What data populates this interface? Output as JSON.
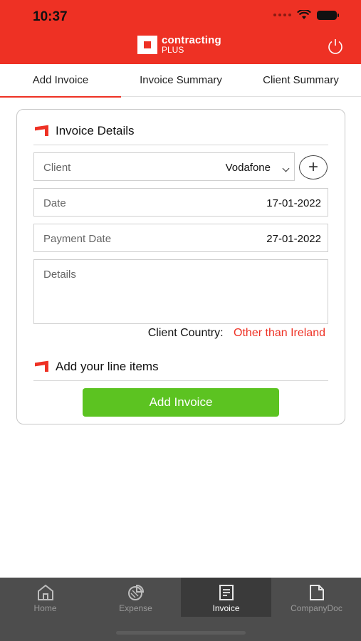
{
  "status_bar": {
    "time": "10:37"
  },
  "header": {
    "brand_line1": "contracting",
    "brand_line2": "PLUS"
  },
  "tabs": [
    {
      "label": "Add Invoice",
      "active": true
    },
    {
      "label": "Invoice Summary",
      "active": false
    },
    {
      "label": "Client Summary",
      "active": false
    }
  ],
  "invoice_details": {
    "title": "Invoice Details",
    "client": {
      "label": "Client",
      "value": "Vodafone"
    },
    "date": {
      "label": "Date",
      "value": "17-01-2022"
    },
    "payment_date": {
      "label": "Payment Date",
      "value": "27-01-2022"
    },
    "details": {
      "label": "Details",
      "value": ""
    },
    "client_country_label": "Client Country:",
    "client_country_value": "Other than Ireland"
  },
  "line_items": {
    "title": "Add your line items"
  },
  "add_invoice_button": "Add Invoice",
  "bottom_nav": [
    {
      "label": "Home",
      "icon": "home-icon",
      "active": false
    },
    {
      "label": "Expense",
      "icon": "expense-icon",
      "active": false
    },
    {
      "label": "Invoice",
      "icon": "invoice-icon",
      "active": true
    },
    {
      "label": "CompanyDoc",
      "icon": "document-icon",
      "active": false
    }
  ],
  "colors": {
    "brand_red": "#ee3124",
    "button_green": "#5cc321",
    "nav_bg": "#4d4d4d"
  }
}
